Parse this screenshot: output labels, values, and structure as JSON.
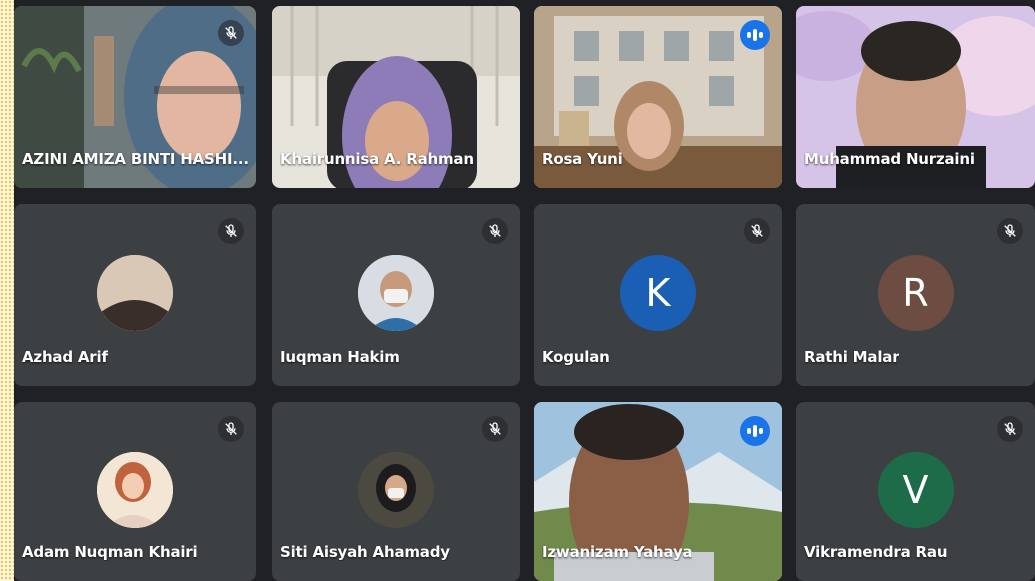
{
  "participants": [
    {
      "name": "AZINI AMIZA BINTI HASHI...",
      "muted": true,
      "speaking": false
    },
    {
      "name": "Khairunnisa A. Rahman",
      "muted": false,
      "speaking": false
    },
    {
      "name": "Rosa Yuni",
      "muted": false,
      "speaking": true
    },
    {
      "name": "Muhammad Nurzaini",
      "muted": false,
      "speaking": false
    },
    {
      "name": "Azhad Arif",
      "muted": true,
      "speaking": false
    },
    {
      "name": "Iuqman Hakim",
      "muted": true,
      "speaking": false
    },
    {
      "name": "Kogulan",
      "initial": "K",
      "muted": true,
      "speaking": false,
      "avatar_color": "#1a5fb4"
    },
    {
      "name": "Rathi Malar",
      "initial": "R",
      "muted": true,
      "speaking": false,
      "avatar_color": "#6d4c41"
    },
    {
      "name": "Adam Nuqman Khairi",
      "muted": true,
      "speaking": false
    },
    {
      "name": "Siti Aisyah Ahamady",
      "muted": true,
      "speaking": false
    },
    {
      "name": "Izwanizam Yahaya",
      "muted": false,
      "speaking": true
    },
    {
      "name": "Vikramendra Rau",
      "initial": "V",
      "muted": true,
      "speaking": false,
      "avatar_color": "#1e6b4a"
    }
  ],
  "icons": {
    "mute": "mic-off-icon",
    "speaking": "audio-level-icon"
  },
  "colors": {
    "stage_bg": "#202124",
    "tile_bg": "#3c4043",
    "speaking_outline": "#8ab4f8",
    "speaking_badge": "#1a73e8"
  }
}
